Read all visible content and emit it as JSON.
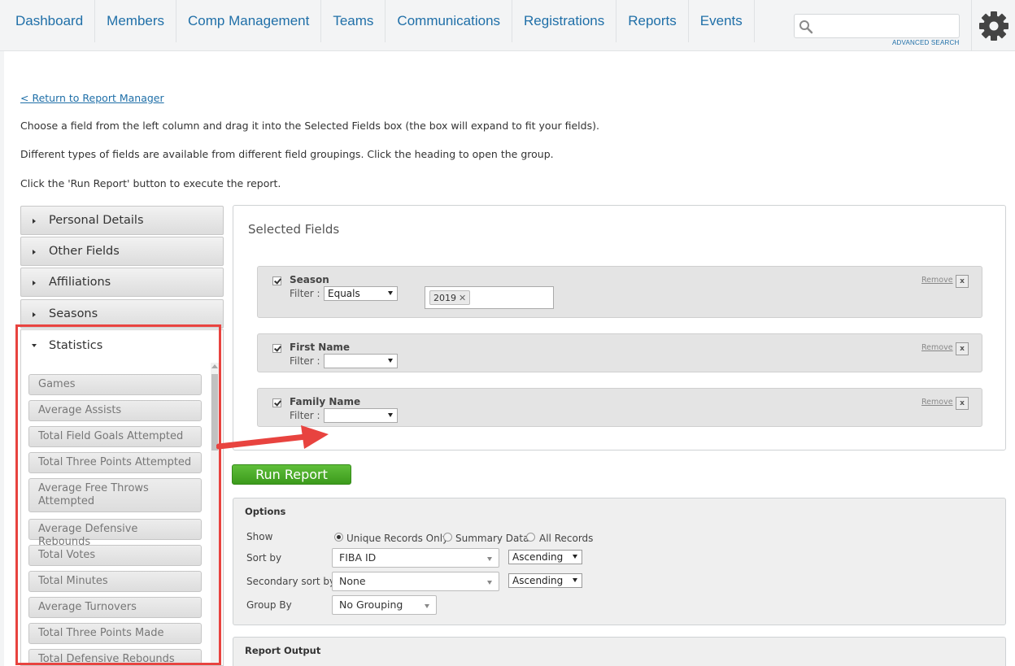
{
  "nav": {
    "items": [
      "Dashboard",
      "Members",
      "Comp Management",
      "Teams",
      "Communications",
      "Registrations",
      "Reports",
      "Events"
    ],
    "search_placeholder": "",
    "advanced_search": "ADVANCED SEARCH",
    "accent_color": "#1f6fa8"
  },
  "intro": {
    "return_link": "< Return to Report Manager",
    "line1": "Choose a field from the left column and drag it into the Selected Fields box (the box will expand to fit your fields).",
    "line2": "Different types of fields are available from different field groupings. Click the heading to open the group.",
    "line3": "Click the 'Run Report' button to execute the report."
  },
  "groups": {
    "closed": [
      "Personal Details",
      "Other Fields",
      "Affiliations",
      "Seasons"
    ],
    "open": {
      "title": "Statistics",
      "fields": [
        "Games",
        "Average Assists",
        "Total Field Goals Attempted",
        "Total Three Points Attempted",
        "Average Free Throws Attempted",
        "Average Defensive Rebounds",
        "Total Votes",
        "Total Minutes",
        "Average Turnovers",
        "Total Three Points Made",
        "Total Defensive Rebounds"
      ]
    }
  },
  "selected": {
    "title": "Selected Fields",
    "filter_label": "Filter :",
    "remove_label": "Remove",
    "x_label": "x",
    "fields": [
      {
        "name": "Season",
        "filter": "Equals",
        "tag": "2019"
      },
      {
        "name": "First Name",
        "filter": ""
      },
      {
        "name": "Family Name",
        "filter": ""
      }
    ]
  },
  "run_report": "Run Report",
  "options": {
    "title": "Options",
    "show_label": "Show",
    "show_options": [
      "Unique Records Only",
      "Summary Data",
      "All Records"
    ],
    "show_selected": "Unique Records Only",
    "sort_label": "Sort by",
    "sort_value": "FIBA ID",
    "sort_order": "Ascending",
    "secondary_label": "Secondary sort by",
    "secondary_value": "None",
    "secondary_order": "Ascending",
    "group_label": "Group By",
    "group_value": "No Grouping"
  },
  "output": {
    "title": "Report Output"
  },
  "colors": {
    "highlight_box": "#e8433f",
    "run_button": "#4aab26"
  }
}
